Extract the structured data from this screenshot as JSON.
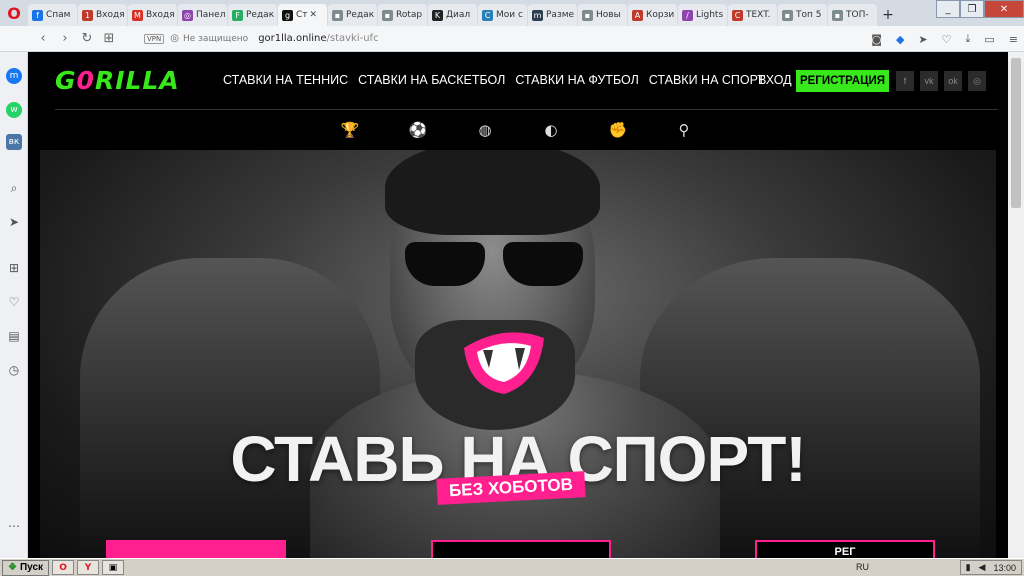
{
  "browser": {
    "tabs": [
      {
        "label": "Спам",
        "fav_color": "#1a73e8",
        "fav_text": "f"
      },
      {
        "label": "Входя",
        "fav_color": "#c0392b",
        "fav_text": "1"
      },
      {
        "label": "Входя",
        "fav_color": "#d93025",
        "fav_text": "M"
      },
      {
        "label": "Панел",
        "fav_color": "#8e44ad",
        "fav_text": "◎"
      },
      {
        "label": "Редак",
        "fav_color": "#27ae60",
        "fav_text": "F"
      },
      {
        "label": "Ст",
        "fav_color": "#111111",
        "fav_text": "g"
      },
      {
        "label": "Редак",
        "fav_color": "#7f8c8d",
        "fav_text": "▪"
      },
      {
        "label": "Rotap",
        "fav_color": "#7f8c8d",
        "fav_text": "▪"
      },
      {
        "label": "Диал",
        "fav_color": "#222222",
        "fav_text": "K"
      },
      {
        "label": "Мои с",
        "fav_color": "#2980b9",
        "fav_text": "C"
      },
      {
        "label": "Разме",
        "fav_color": "#2c3e50",
        "fav_text": "m"
      },
      {
        "label": "Новы",
        "fav_color": "#7f8c8d",
        "fav_text": "▪"
      },
      {
        "label": "Корзи",
        "fav_color": "#c0392b",
        "fav_text": "A"
      },
      {
        "label": "Lights",
        "fav_color": "#8e44ad",
        "fav_text": "/"
      },
      {
        "label": "TEXT.",
        "fav_color": "#c0392b",
        "fav_text": "C"
      },
      {
        "label": "Топ 5",
        "fav_color": "#7f8c8d",
        "fav_text": "▪"
      },
      {
        "label": "ТОП-",
        "fav_color": "#7f8c8d",
        "fav_text": "▪"
      }
    ],
    "new_tab": "+",
    "address": {
      "vpn": "VPN",
      "secure": "Не защищено",
      "domain": "gor1lla.online",
      "path": "/stavki-ufc"
    }
  },
  "site": {
    "logo_prefix": "G",
    "logo_o": "0",
    "logo_suffix": "RILLA",
    "nav": [
      "СТАВКИ НА ТЕННИС",
      "СТАВКИ НА БАСКЕТБОЛ",
      "СТАВКИ НА ФУТБОЛ",
      "СТАВКИ НА СПОРТ"
    ],
    "login": "ВХОД",
    "register": "РЕГИСТРАЦИЯ",
    "socials": [
      "f",
      "vk",
      "ok",
      "◎"
    ],
    "sports": [
      {
        "icon": "trophy-icon",
        "glyph": "🏆"
      },
      {
        "icon": "football-icon",
        "glyph": "⚽"
      },
      {
        "icon": "basketball-icon",
        "glyph": "◍"
      },
      {
        "icon": "tennis-icon",
        "glyph": "◐"
      },
      {
        "icon": "boxing-icon",
        "glyph": "✊"
      },
      {
        "icon": "badminton-icon",
        "glyph": "⚲"
      }
    ],
    "hero_title": "СТАВЬ НА СПОРТ!",
    "hero_sticker": "БЕЗ ХОБОТОВ",
    "cta_third_label": "РЕГ"
  },
  "taskbar": {
    "start": "Пуск",
    "lang": "RU",
    "time": "13:00"
  },
  "colors": {
    "brand_green": "#37e81b",
    "brand_pink": "#ff1f8e"
  }
}
